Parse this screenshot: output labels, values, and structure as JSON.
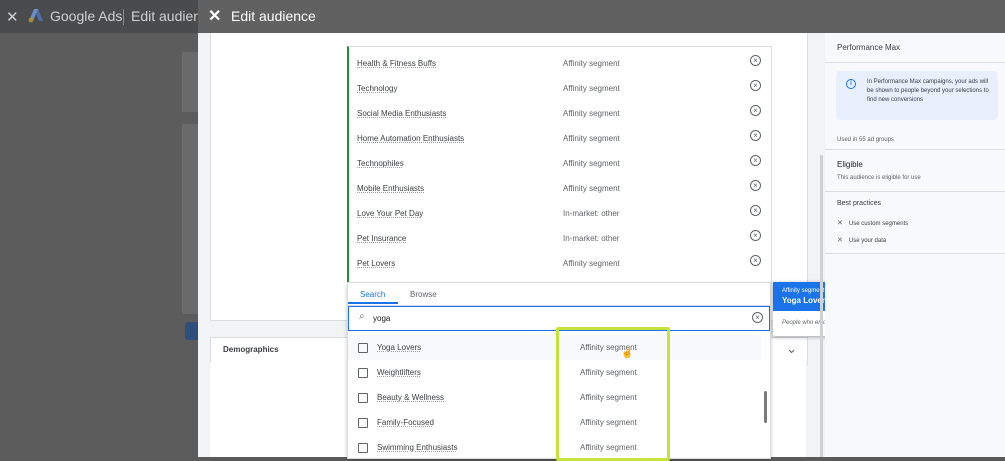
{
  "background_app": {
    "brand": "Google Ads",
    "breadcrumb": "Edit audience"
  },
  "modal": {
    "title": "Edit audience"
  },
  "selected_segments": [
    {
      "name": "Health & Fitness Buffs",
      "type": "Affinity segment"
    },
    {
      "name": "Technology",
      "type": "Affinity segment"
    },
    {
      "name": "Social Media Enthusiasts",
      "type": "Affinity segment"
    },
    {
      "name": "Home Automation Enthusiasts",
      "type": "Affinity segment"
    },
    {
      "name": "Technophiles",
      "type": "Affinity segment"
    },
    {
      "name": "Mobile Enthusiasts",
      "type": "Affinity segment"
    },
    {
      "name": "Love Your Pet Day",
      "type": "In-market: other"
    },
    {
      "name": "Pet Insurance",
      "type": "In-market: other"
    },
    {
      "name": "Pet Lovers",
      "type": "Affinity segment"
    }
  ],
  "picker": {
    "tabs": [
      "Search",
      "Browse"
    ],
    "active_tab": "Search",
    "search_value": "yoga",
    "results": [
      {
        "name": "Yoga Lovers",
        "type": "Affinity segment"
      },
      {
        "name": "Weightlifters",
        "type": "Affinity segment"
      },
      {
        "name": "Beauty & Wellness",
        "type": "Affinity segment"
      },
      {
        "name": "Family-Focused",
        "type": "Affinity segment"
      },
      {
        "name": "Swimming Enthusiasts",
        "type": "Affinity segment"
      }
    ]
  },
  "tooltip": {
    "kind": "Affinity segment",
    "title": "Yoga Lovers",
    "description": "People who enjoy practicing yoga"
  },
  "demographics_label": "Demographics",
  "sidebar": {
    "performance_max": "Performance Max",
    "info_text": "In Performance Max campaigns, your ads will be shown to people beyond your selections to find new conversions",
    "used_in": "Used in 55 ad groups",
    "eligible": "Eligible",
    "eligible_sub": "This audience is eligible for use",
    "best_practices": "Best practices",
    "practices": [
      "Use custom segments",
      "Use your data"
    ]
  },
  "colors": {
    "accent": "#1a73e8",
    "selected_border": "#1e8e3e",
    "highlight": "#c6e33b"
  }
}
